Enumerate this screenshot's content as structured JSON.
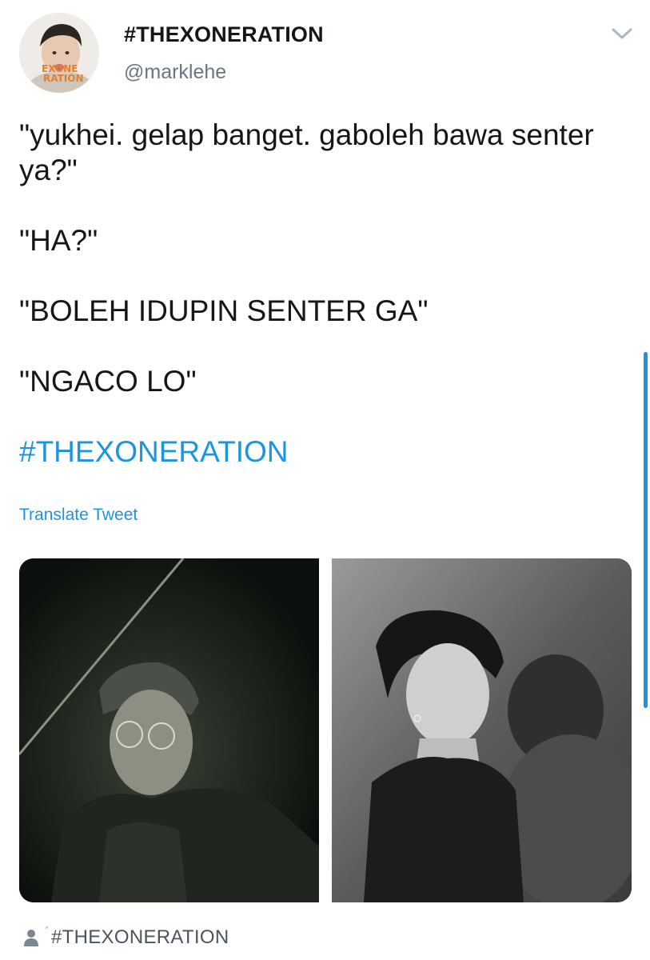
{
  "tweet": {
    "display_name": "#THEXONERATION",
    "username": "@marklehe",
    "lines": [
      "\"yukhei. gelap banget. gaboleh bawa senter\nya?\"",
      "\"HA?\"",
      "\"BOLEH IDUPIN SENTER GA\"",
      "\"NGACO LO\""
    ],
    "hashtag": "#THEXONERATION",
    "translate_label": "Translate Tweet",
    "avatar_text": [
      "EXONE",
      "RATION"
    ]
  },
  "footer": {
    "mark": "´",
    "label": "#THEXONERATION"
  },
  "icons": {
    "menu": "chevron-down-icon",
    "footer": "person-icon"
  },
  "colors": {
    "link": "#1b95e0",
    "text": "#14171a",
    "secondary": "#657786"
  }
}
